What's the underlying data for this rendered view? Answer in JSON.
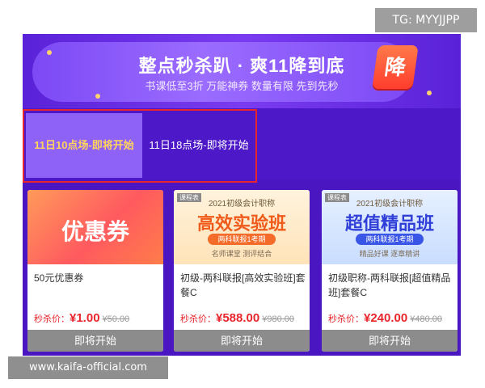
{
  "watermarks": {
    "top": "TG: MYYJJPP",
    "bottom": "www.kaifa-official.com"
  },
  "banner": {
    "title": "整点秒杀趴 · 爽11降到底",
    "subtitle": "书课低至3折  万能神券  数量有限  先到先秒",
    "badge": "降"
  },
  "tabs": [
    {
      "label": "11日10点场-即将开始",
      "active": true
    },
    {
      "label": "11日18点场-即将开始",
      "active": false
    }
  ],
  "accent_colors": {
    "panel": "#4a16c2",
    "active_tab": "#8f62f7",
    "active_tab_text": "#ffd45a",
    "price_red": "#e8252c",
    "button_gray": "#8c8c8c"
  },
  "products": [
    {
      "image_title": "优惠券",
      "name": "50元优惠券",
      "price_label": "秒杀价：",
      "price": "¥1.00",
      "original_price": "¥50.00",
      "button": "即将开始"
    },
    {
      "image_corner": "课程表",
      "image_small": "2021初级会计职称",
      "image_title": "高效实验班",
      "image_strip": "两科联报1考期",
      "image_tags": "名师课堂   测评结合",
      "name": "初级-两科联报[高效实验班]套餐C",
      "price_label": "秒杀价：",
      "price": "¥588.00",
      "original_price": "¥980.00",
      "button": "即将开始"
    },
    {
      "image_corner": "课程表",
      "image_small": "2021初级会计职称",
      "image_title": "超值精品班",
      "image_strip": "两科联报1考期",
      "image_tags": "精品好课   逐章精讲",
      "name": "初级职称-两科联报[超值精品班]套餐C",
      "price_label": "秒杀价：",
      "price": "¥240.00",
      "original_price": "¥480.00",
      "button": "即将开始"
    }
  ]
}
